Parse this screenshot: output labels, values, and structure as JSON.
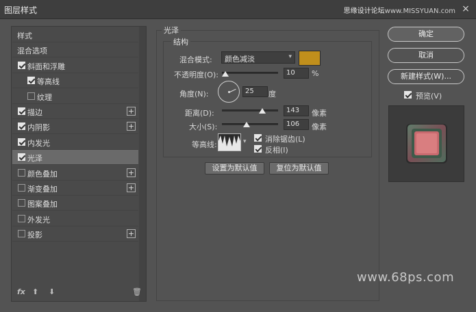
{
  "titlebar": {
    "title": "图层样式",
    "watermark": "思缘设计论坛",
    "watermark_site": "www.MISSYUAN.com",
    "close": "×"
  },
  "left_panel": {
    "items": [
      {
        "label": "样式",
        "checkbox": false,
        "checked": false,
        "plus": false,
        "selected": false
      },
      {
        "label": "混合选项",
        "checkbox": false,
        "checked": false,
        "plus": false,
        "selected": false
      },
      {
        "label": "斜面和浮雕",
        "checkbox": true,
        "checked": true,
        "plus": false,
        "selected": false
      },
      {
        "label": "等高线",
        "checkbox": true,
        "checked": true,
        "plus": false,
        "selected": false,
        "indent": true
      },
      {
        "label": "纹理",
        "checkbox": true,
        "checked": false,
        "plus": false,
        "selected": false,
        "indent": true
      },
      {
        "label": "描边",
        "checkbox": true,
        "checked": true,
        "plus": true,
        "selected": false
      },
      {
        "label": "内阴影",
        "checkbox": true,
        "checked": true,
        "plus": true,
        "selected": false
      },
      {
        "label": "内发光",
        "checkbox": true,
        "checked": true,
        "plus": false,
        "selected": false
      },
      {
        "label": "光泽",
        "checkbox": true,
        "checked": true,
        "plus": false,
        "selected": true
      },
      {
        "label": "颜色叠加",
        "checkbox": true,
        "checked": false,
        "plus": true,
        "selected": false
      },
      {
        "label": "渐变叠加",
        "checkbox": true,
        "checked": false,
        "plus": true,
        "selected": false
      },
      {
        "label": "图案叠加",
        "checkbox": true,
        "checked": false,
        "plus": false,
        "selected": false
      },
      {
        "label": "外发光",
        "checkbox": true,
        "checked": false,
        "plus": false,
        "selected": false
      },
      {
        "label": "投影",
        "checkbox": true,
        "checked": false,
        "plus": true,
        "selected": false
      }
    ],
    "footer": {
      "fx": "fx",
      "up": "⬆",
      "down": "⬇",
      "trash": "🗑"
    }
  },
  "satin": {
    "section_title": "光泽",
    "group_title": "结构",
    "blend_mode_label": "混合模式:",
    "blend_mode_value": "颜色减淡",
    "color": "#c08f1c",
    "opacity_label": "不透明度(O):",
    "opacity_value": "10",
    "opacity_unit": "%",
    "opacity_level": 0.1,
    "angle_label": "角度(N):",
    "angle_value": "25",
    "angle_unit": "度",
    "distance_label": "距离(D):",
    "distance_value": "143",
    "distance_unit": "像素",
    "distance_level": 0.57,
    "size_label": "大小(S):",
    "size_value": "106",
    "size_unit": "像素",
    "size_level": 0.42,
    "contour_label": "等高线:",
    "antialias_label": "消除锯齿(L)",
    "invert_label": "反相(I)",
    "make_default": "设置为默认值",
    "reset_default": "复位为默认值"
  },
  "right_panel": {
    "ok": "确定",
    "cancel": "取消",
    "new_style": "新建样式(W)...",
    "preview_label": "预览(V)"
  },
  "watermark_bottom": "www.68ps.com"
}
